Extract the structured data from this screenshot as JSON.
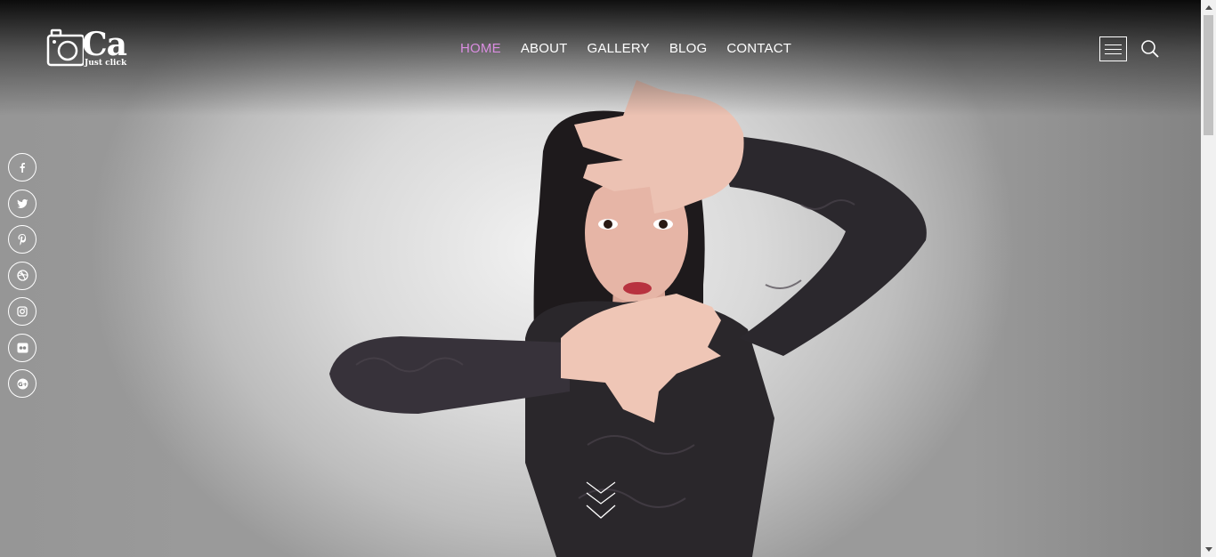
{
  "logo": {
    "mark": "Ca",
    "tagline": "Just click",
    "icon": "camera-icon"
  },
  "nav": {
    "items": [
      {
        "label": "HOME",
        "active": true
      },
      {
        "label": "ABOUT",
        "active": false
      },
      {
        "label": "GALLERY",
        "active": false
      },
      {
        "label": "BLOG",
        "active": false
      },
      {
        "label": "CONTACT",
        "active": false
      }
    ],
    "active_color": "#d98de0"
  },
  "header_icons": [
    "hamburger-menu-icon",
    "search-icon"
  ],
  "social": [
    {
      "name": "facebook-icon",
      "glyph": "f"
    },
    {
      "name": "twitter-icon",
      "glyph": ""
    },
    {
      "name": "pinterest-icon",
      "glyph": "P"
    },
    {
      "name": "dribbble-icon",
      "glyph": ""
    },
    {
      "name": "instagram-icon",
      "glyph": ""
    },
    {
      "name": "flickr-icon",
      "glyph": ""
    },
    {
      "name": "google-plus-icon",
      "glyph": "G+"
    }
  ],
  "hero": {
    "scroll_icon": "chevron-down-icon"
  }
}
